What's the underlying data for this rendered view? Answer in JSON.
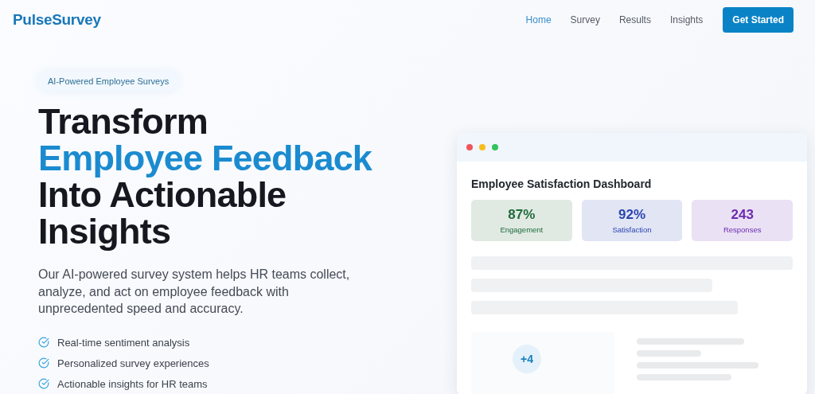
{
  "brand": "PulseSurvey",
  "nav": [
    {
      "label": "Home",
      "selected": true
    },
    {
      "label": "Survey",
      "selected": false
    },
    {
      "label": "Results",
      "selected": false
    },
    {
      "label": "Insights",
      "selected": false
    }
  ],
  "cta": "Get Started",
  "hero": {
    "badge": "AI-Powered Employee Surveys",
    "headline": [
      {
        "text": "Transform",
        "highlight": false
      },
      {
        "text": "Employee Feedback",
        "highlight": true
      },
      {
        "text": "Into Actionable",
        "highlight": false
      },
      {
        "text": "Insights",
        "highlight": false
      }
    ],
    "description": "Our AI-powered survey system helps HR teams collect, analyze, and act on employee feedback with unprecedented speed and accuracy.",
    "features": [
      "Real-time sentiment analysis",
      "Personalized survey experiences",
      "Actionable insights for HR teams"
    ]
  },
  "dashboard": {
    "title": "Employee Satisfaction Dashboard",
    "stats": [
      {
        "value": "87%",
        "label": "Engagement",
        "color": "#1f6b3a"
      },
      {
        "value": "92%",
        "label": "Satisfaction",
        "color": "#2a44b0"
      },
      {
        "value": "243",
        "label": "Responses",
        "color": "#6b2bb0"
      }
    ],
    "bubble": "+4"
  }
}
